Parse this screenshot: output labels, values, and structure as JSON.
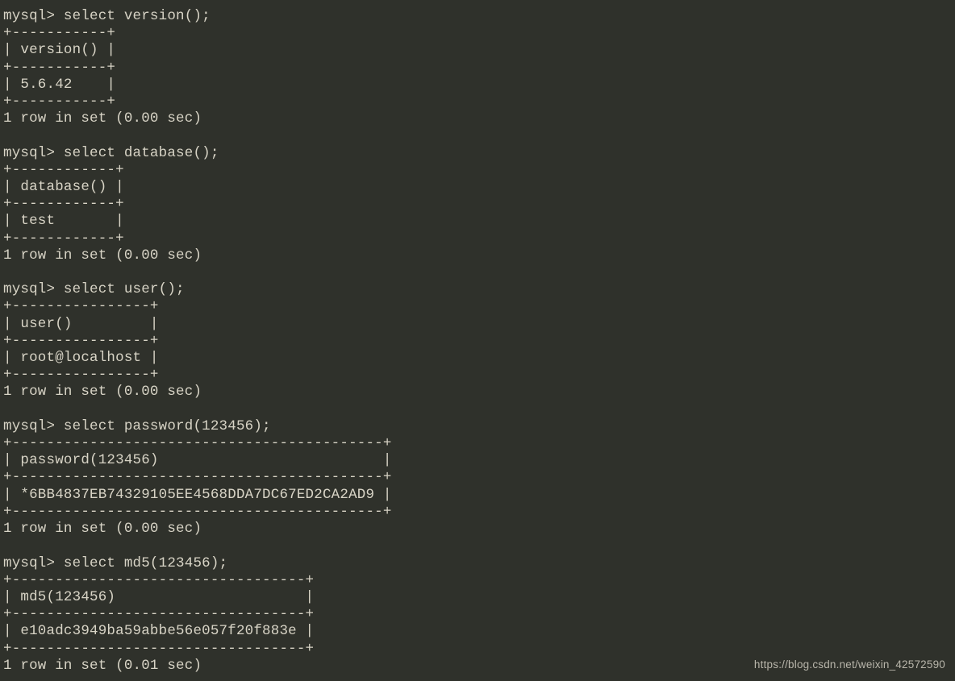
{
  "terminal": {
    "lines": [
      "mysql> select version();",
      "+-----------+",
      "| version() |",
      "+-----------+",
      "| 5.6.42    |",
      "+-----------+",
      "1 row in set (0.00 sec)",
      "",
      "mysql> select database();",
      "+------------+",
      "| database() |",
      "+------------+",
      "| test       |",
      "+------------+",
      "1 row in set (0.00 sec)",
      "",
      "mysql> select user();",
      "+----------------+",
      "| user()         |",
      "+----------------+",
      "| root@localhost |",
      "+----------------+",
      "1 row in set (0.00 sec)",
      "",
      "mysql> select password(123456);",
      "+-------------------------------------------+",
      "| password(123456)                          |",
      "+-------------------------------------------+",
      "| *6BB4837EB74329105EE4568DDA7DC67ED2CA2AD9 |",
      "+-------------------------------------------+",
      "1 row in set (0.00 sec)",
      "",
      "mysql> select md5(123456);",
      "+----------------------------------+",
      "| md5(123456)                      |",
      "+----------------------------------+",
      "| e10adc3949ba59abbe56e057f20f883e |",
      "+----------------------------------+",
      "1 row in set (0.01 sec)"
    ]
  },
  "queries": [
    {
      "sql": "select version();",
      "column": "version()",
      "value": "5.6.42",
      "time": "0.00"
    },
    {
      "sql": "select database();",
      "column": "database()",
      "value": "test",
      "time": "0.00"
    },
    {
      "sql": "select user();",
      "column": "user()",
      "value": "root@localhost",
      "time": "0.00"
    },
    {
      "sql": "select password(123456);",
      "column": "password(123456)",
      "value": "*6BB4837EB74329105EE4568DDA7DC67ED2CA2AD9",
      "time": "0.00"
    },
    {
      "sql": "select md5(123456);",
      "column": "md5(123456)",
      "value": "e10adc3949ba59abbe56e057f20f883e",
      "time": "0.01"
    }
  ],
  "watermark": "https://blog.csdn.net/weixin_42572590"
}
